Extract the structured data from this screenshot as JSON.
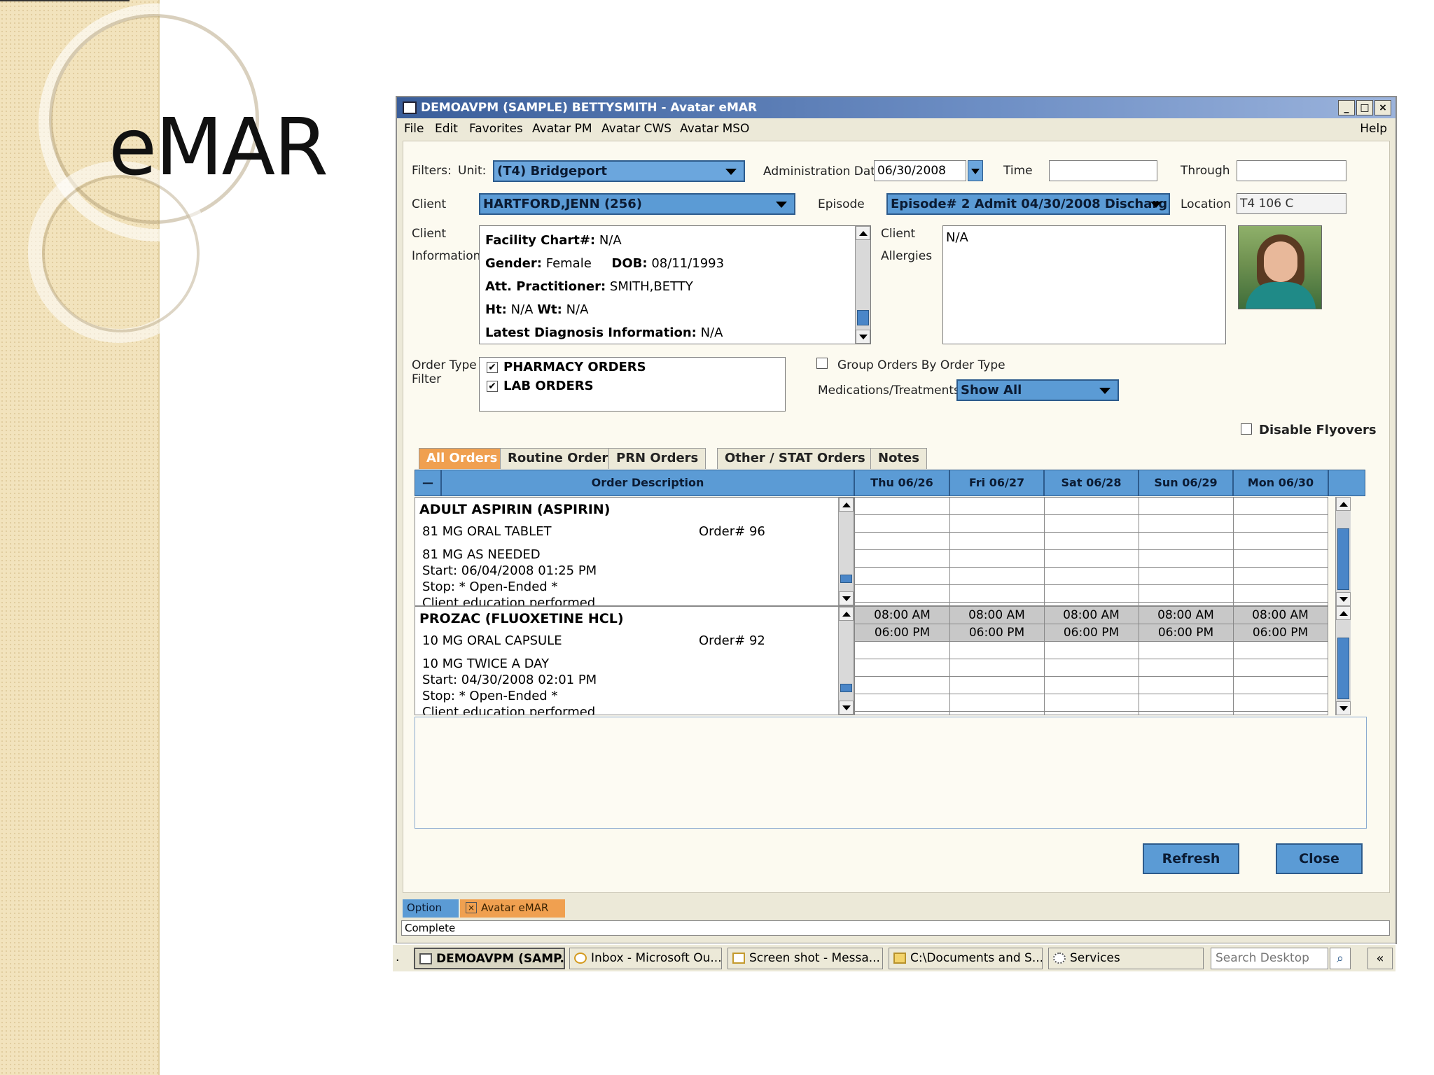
{
  "slide": {
    "title": "eMAR"
  },
  "window": {
    "title": "DEMOAVPM (SAMPLE) BETTYSMITH - Avatar eMAR",
    "controls": {
      "minimize": "_",
      "maximize": "□",
      "close": "×"
    },
    "menu": [
      "File",
      "Edit",
      "Favorites",
      "Avatar PM",
      "Avatar CWS",
      "Avatar MSO"
    ],
    "help": "Help"
  },
  "filters": {
    "label": "Filters:",
    "unit_label": "Unit:",
    "unit_value": "(T4) Bridgeport",
    "admin_date_label": "Administration Date",
    "admin_date_value": "06/30/2008",
    "time_label": "Time",
    "time_value": "",
    "through_label": "Through",
    "through_value": ""
  },
  "client": {
    "label": "Client",
    "value": "HARTFORD,JENN (256)",
    "episode_label": "Episode",
    "episode_value": "Episode# 2  Admit 04/30/2008 Discharg...",
    "location_label": "Location",
    "location_value": "T4 106 C",
    "info_label_1": "Client",
    "info_label_2": "Information",
    "info": {
      "facility_label": "Facility Chart#:",
      "facility_value": "N/A",
      "gender_label": "Gender:",
      "gender_value": "Female",
      "dob_label": "DOB:",
      "dob_value": "08/11/1993",
      "practitioner_label": "Att. Practitioner:",
      "practitioner_value": "SMITH,BETTY",
      "ht_label": "Ht:",
      "ht_value": "N/A",
      "wt_label": "Wt:",
      "wt_value": "N/A",
      "diagnosis_label": "Latest Diagnosis Information:",
      "diagnosis_value": "N/A"
    },
    "allergies_label_1": "Client",
    "allergies_label_2": "Allergies",
    "allergies_value": "N/A"
  },
  "order_type": {
    "label_1": "Order Type",
    "label_2": "Filter",
    "items": [
      {
        "label": "PHARMACY ORDERS",
        "checked": true
      },
      {
        "label": "LAB ORDERS",
        "checked": true
      }
    ],
    "group_label": "Group Orders By Order Type",
    "group_checked": false,
    "meds_label": "Medications/Treatments",
    "meds_value": "Show All",
    "disable_flyovers_label": "Disable Flyovers",
    "disable_flyovers_checked": false
  },
  "tabs": [
    {
      "label": "All Orders",
      "active": true
    },
    {
      "label": "Routine Orders",
      "active": false
    },
    {
      "label": "PRN Orders",
      "active": false
    },
    {
      "label": "Other / STAT Orders",
      "active": false
    },
    {
      "label": "Notes",
      "active": false
    }
  ],
  "grid": {
    "collapse_symbol": "—",
    "desc_header": "Order Description",
    "days": [
      "Thu   06/26",
      "Fri   06/27",
      "Sat   06/28",
      "Sun   06/29",
      "Mon   06/30"
    ],
    "orders": [
      {
        "title": "ADULT ASPIRIN (ASPIRIN)",
        "dose": "81 MG ORAL TABLET",
        "order_no": "Order# 96",
        "freq": "81 MG AS NEEDED",
        "start": "Start: 06/04/2008 01:25 PM",
        "stop": "Stop: * Open-Ended *",
        "note": "Client education performed",
        "times": [
          "",
          ""
        ]
      },
      {
        "title": "PROZAC (FLUOXETINE HCL)",
        "dose": "10 MG ORAL CAPSULE",
        "order_no": "Order# 92",
        "freq": "10 MG TWICE A DAY",
        "start": "Start: 04/30/2008 02:01 PM",
        "stop": "Stop: * Open-Ended *",
        "note": "Client education performed",
        "times": [
          "08:00 AM",
          "06:00 PM"
        ]
      }
    ]
  },
  "buttons": {
    "refresh": "Refresh",
    "close": "Close"
  },
  "bottom_tabs": {
    "option": "Option",
    "emar": "Avatar eMAR"
  },
  "status": "Complete",
  "taskbar": {
    "lead": ".",
    "items": [
      {
        "label": "DEMOAVPM (SAMP...",
        "active": true
      },
      {
        "label": "Inbox - Microsoft Ou...",
        "active": false
      },
      {
        "label": "Screen shot - Messa...",
        "active": false
      },
      {
        "label": "C:\\Documents and S...",
        "active": false
      },
      {
        "label": "Services",
        "active": false
      }
    ],
    "search_placeholder": "Search Desktop",
    "more": "«"
  },
  "colors": {
    "accent_blue": "#5b9bd5",
    "active_tab": "#f0a050",
    "window_bg": "#ece9d8"
  }
}
